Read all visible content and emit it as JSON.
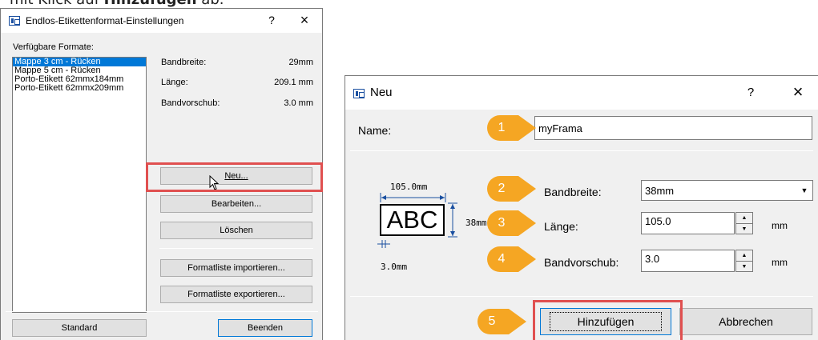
{
  "caption": {
    "prefix": "mit Klick auf ",
    "bold": "Hinzufügen",
    "suffix": " ab."
  },
  "dialog1": {
    "title": "Endlos-Etikettenformat-Einstellungen",
    "help": "?",
    "close": "×",
    "available_label": "Verfügbare Formate:",
    "formats": [
      "Mappe 3 cm - Rücken",
      "Mappe 5 cm - Rücken",
      "Porto-Etikett 62mmx184mm",
      "Porto-Etikett 62mmx209mm"
    ],
    "selected_index": 0,
    "props": [
      {
        "label": "Bandbreite:",
        "value": "29mm"
      },
      {
        "label": "Länge:",
        "value": "209.1 mm"
      },
      {
        "label": "Bandvorschub:",
        "value": "3.0 mm"
      }
    ],
    "buttons": {
      "new": "Neu...",
      "edit": "Bearbeiten...",
      "delete": "Löschen",
      "import": "Formatliste importieren...",
      "export": "Formatliste exportieren...",
      "standard": "Standard",
      "quit": "Beenden"
    }
  },
  "dialog2": {
    "title": "Neu",
    "help": "?",
    "close": "×",
    "name_label": "Name:",
    "name_value": "myFrama",
    "width_label": "Bandbreite:",
    "width_value": "38mm",
    "length_label": "Länge:",
    "length_value": "105.0",
    "length_unit": "mm",
    "feed_label": "Bandvorschub:",
    "feed_value": "3.0",
    "feed_unit": "mm",
    "preview": {
      "top_dim": "105.0mm",
      "sample": "ABC",
      "side_dim": "38mm",
      "bottom_dim": "3.0mm"
    },
    "add_button": "Hinzufügen",
    "cancel_button": "Abbrechen"
  },
  "markers": [
    "1",
    "2",
    "3",
    "4",
    "5"
  ],
  "colors": {
    "highlight": "#e05050",
    "marker": "#f5a623",
    "dimension": "#1a4fa0",
    "selection": "#0078d7"
  }
}
